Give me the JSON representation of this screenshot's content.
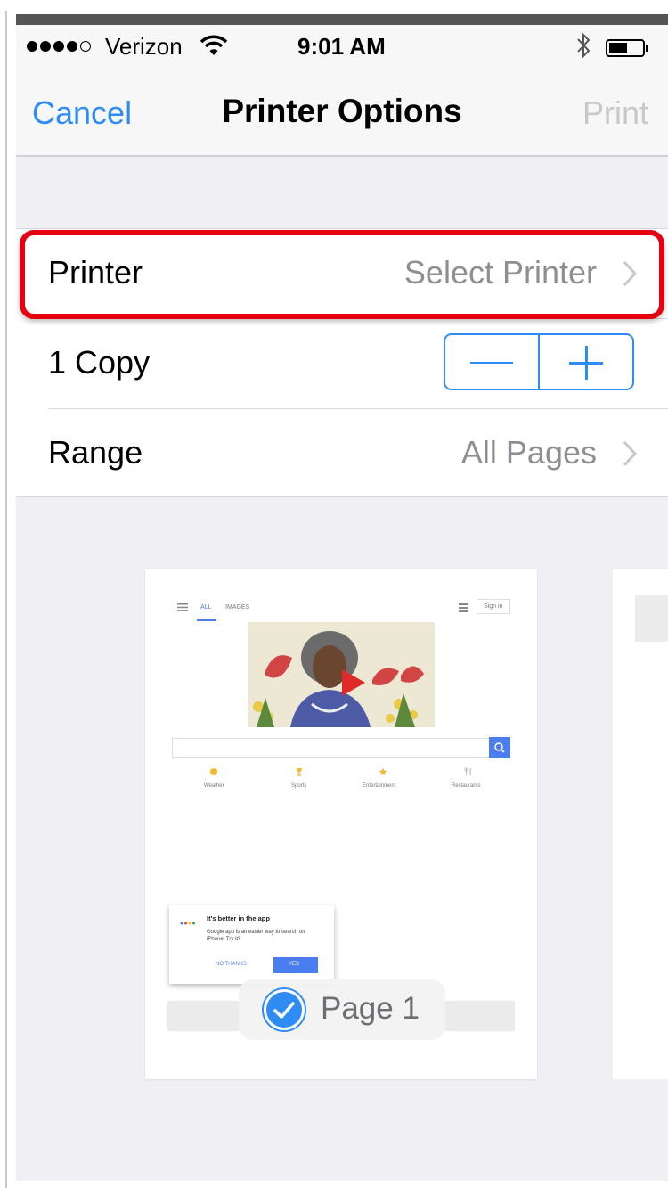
{
  "status_bar": {
    "carrier": "Verizon",
    "time": "9:01 AM"
  },
  "nav": {
    "cancel_label": "Cancel",
    "title": "Printer Options",
    "print_label": "Print"
  },
  "options": {
    "printer": {
      "label": "Printer",
      "value": "Select Printer"
    },
    "copies": {
      "label": "1 Copy"
    },
    "range": {
      "label": "Range",
      "value": "All Pages"
    }
  },
  "preview": {
    "page_label": "Page 1",
    "mini_page": {
      "tab_all": "ALL",
      "tab_images": "IMAGES",
      "sign_in": "Sign in",
      "shortcuts": [
        "Weather",
        "Sports",
        "Entertainment",
        "Restaurants"
      ],
      "popup_title": "It's better in the app",
      "popup_body": "Google app is an easier way to search on iPhone. Try it?",
      "popup_no": "NO THANKS",
      "popup_yes": "YES"
    }
  },
  "colors": {
    "accent": "#2f8cf5",
    "highlight": "#e4000f",
    "disabled": "#c7c7cc"
  }
}
